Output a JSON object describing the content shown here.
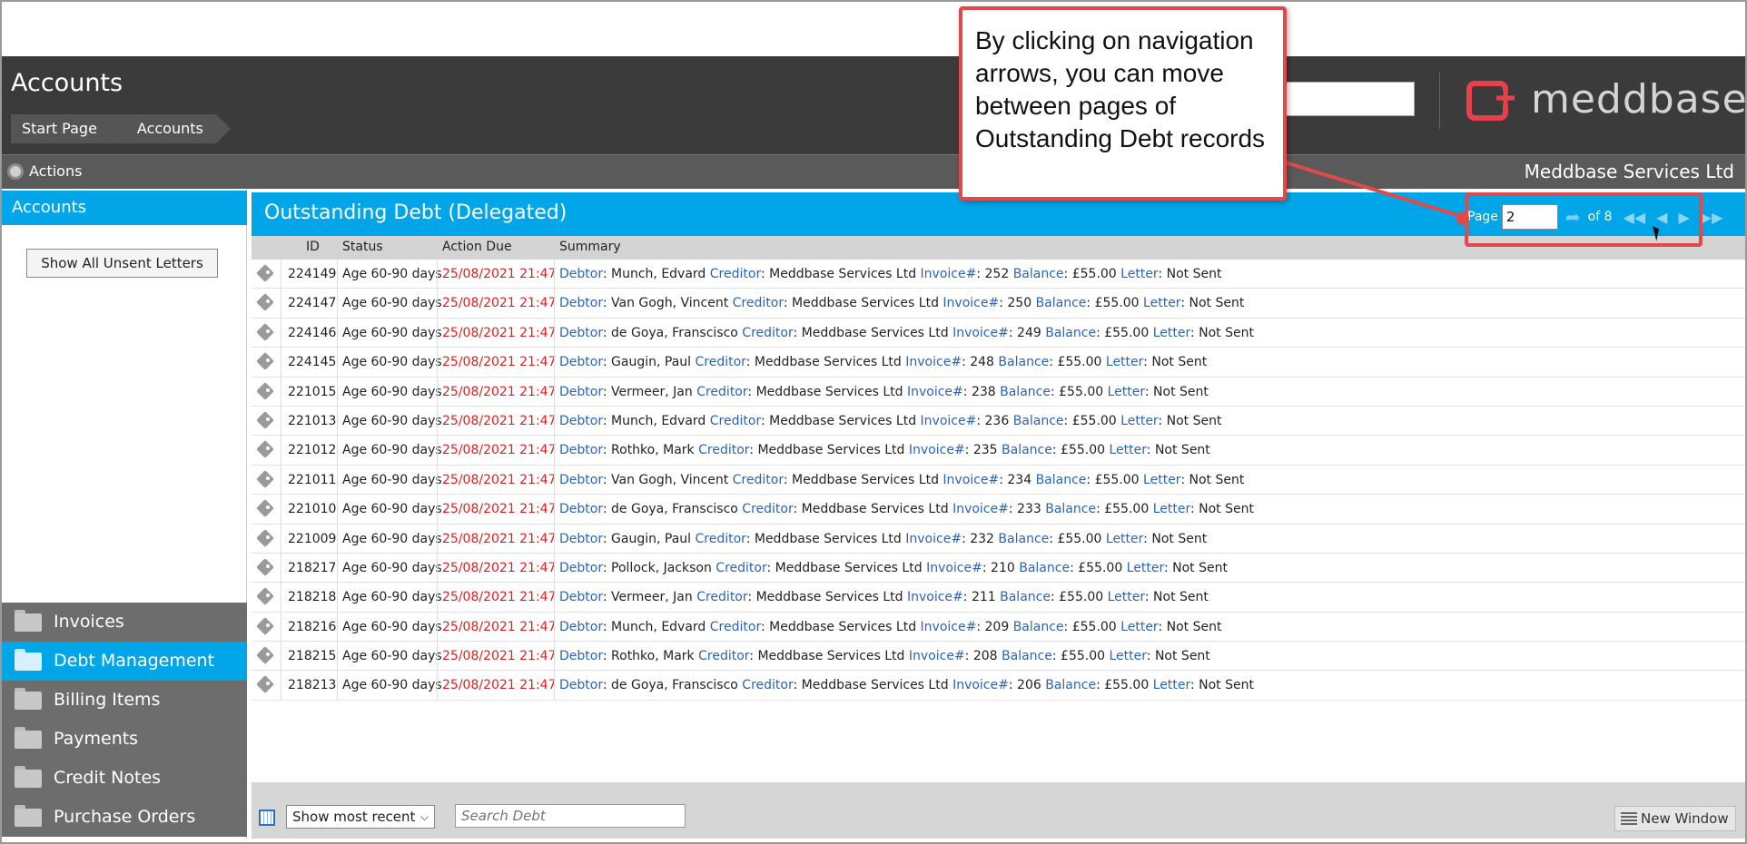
{
  "app": {
    "title": "Accounts",
    "breadcrumb": [
      "Start Page",
      "Accounts"
    ],
    "logo_text": "meddbase",
    "company": "Meddbase Services Ltd",
    "actions_label": "Actions"
  },
  "sidebar": {
    "header": "Accounts",
    "unsent_button": "Show All Unsent Letters",
    "nav": [
      {
        "label": "Invoices",
        "active": false
      },
      {
        "label": "Debt Management",
        "active": true
      },
      {
        "label": "Billing Items",
        "active": false
      },
      {
        "label": "Payments",
        "active": false
      },
      {
        "label": "Credit Notes",
        "active": false
      },
      {
        "label": "Purchase Orders",
        "active": false
      }
    ]
  },
  "main": {
    "title": "Outstanding Debt (Delegated)",
    "pager": {
      "label": "Page",
      "value": "2",
      "of_label": "of 8"
    },
    "columns": [
      "ID",
      "Status",
      "Action Due",
      "Summary"
    ],
    "summary_keys": {
      "debtor": "Debtor",
      "creditor": "Creditor",
      "invoice": "Invoice#",
      "balance": "Balance",
      "letter": "Letter"
    },
    "rows": [
      {
        "id": "224149",
        "status": "Age 60-90 days",
        "due": "25/08/2021 21:47",
        "debtor": "Munch, Edvard",
        "creditor": "Meddbase Services Ltd",
        "invoice": "252",
        "balance": "£55.00",
        "letter": "Not Sent"
      },
      {
        "id": "224147",
        "status": "Age 60-90 days",
        "due": "25/08/2021 21:47",
        "debtor": "Van Gogh, Vincent",
        "creditor": "Meddbase Services Ltd",
        "invoice": "250",
        "balance": "£55.00",
        "letter": "Not Sent"
      },
      {
        "id": "224146",
        "status": "Age 60-90 days",
        "due": "25/08/2021 21:47",
        "debtor": "de Goya, Franscisco",
        "creditor": "Meddbase Services Ltd",
        "invoice": "249",
        "balance": "£55.00",
        "letter": "Not Sent"
      },
      {
        "id": "224145",
        "status": "Age 60-90 days",
        "due": "25/08/2021 21:47",
        "debtor": "Gaugin, Paul",
        "creditor": "Meddbase Services Ltd",
        "invoice": "248",
        "balance": "£55.00",
        "letter": "Not Sent"
      },
      {
        "id": "221015",
        "status": "Age 60-90 days",
        "due": "25/08/2021 21:47",
        "debtor": "Vermeer, Jan",
        "creditor": "Meddbase Services Ltd",
        "invoice": "238",
        "balance": "£55.00",
        "letter": "Not Sent"
      },
      {
        "id": "221013",
        "status": "Age 60-90 days",
        "due": "25/08/2021 21:47",
        "debtor": "Munch, Edvard",
        "creditor": "Meddbase Services Ltd",
        "invoice": "236",
        "balance": "£55.00",
        "letter": "Not Sent"
      },
      {
        "id": "221012",
        "status": "Age 60-90 days",
        "due": "25/08/2021 21:47",
        "debtor": "Rothko, Mark",
        "creditor": "Meddbase Services Ltd",
        "invoice": "235",
        "balance": "£55.00",
        "letter": "Not Sent"
      },
      {
        "id": "221011",
        "status": "Age 60-90 days",
        "due": "25/08/2021 21:47",
        "debtor": "Van Gogh, Vincent",
        "creditor": "Meddbase Services Ltd",
        "invoice": "234",
        "balance": "£55.00",
        "letter": "Not Sent"
      },
      {
        "id": "221010",
        "status": "Age 60-90 days",
        "due": "25/08/2021 21:47",
        "debtor": "de Goya, Franscisco",
        "creditor": "Meddbase Services Ltd",
        "invoice": "233",
        "balance": "£55.00",
        "letter": "Not Sent"
      },
      {
        "id": "221009",
        "status": "Age 60-90 days",
        "due": "25/08/2021 21:47",
        "debtor": "Gaugin, Paul",
        "creditor": "Meddbase Services Ltd",
        "invoice": "232",
        "balance": "£55.00",
        "letter": "Not Sent"
      },
      {
        "id": "218217",
        "status": "Age 60-90 days",
        "due": "25/08/2021 21:47",
        "debtor": "Pollock, Jackson",
        "creditor": "Meddbase Services Ltd",
        "invoice": "210",
        "balance": "£55.00",
        "letter": "Not Sent"
      },
      {
        "id": "218218",
        "status": "Age 60-90 days",
        "due": "25/08/2021 21:47",
        "debtor": "Vermeer, Jan",
        "creditor": "Meddbase Services Ltd",
        "invoice": "211",
        "balance": "£55.00",
        "letter": "Not Sent"
      },
      {
        "id": "218216",
        "status": "Age 60-90 days",
        "due": "25/08/2021 21:47",
        "debtor": "Munch, Edvard",
        "creditor": "Meddbase Services Ltd",
        "invoice": "209",
        "balance": "£55.00",
        "letter": "Not Sent"
      },
      {
        "id": "218215",
        "status": "Age 60-90 days",
        "due": "25/08/2021 21:47",
        "debtor": "Rothko, Mark",
        "creditor": "Meddbase Services Ltd",
        "invoice": "208",
        "balance": "£55.00",
        "letter": "Not Sent"
      },
      {
        "id": "218213",
        "status": "Age 60-90 days",
        "due": "25/08/2021 21:47",
        "debtor": "de Goya, Franscisco",
        "creditor": "Meddbase Services Ltd",
        "invoice": "206",
        "balance": "£55.00",
        "letter": "Not Sent"
      }
    ]
  },
  "footer": {
    "show_select": "Show most recent",
    "search_placeholder": "Search Debt",
    "new_window": "New Window"
  },
  "callout": {
    "text": "By clicking on navigation arrows, you can move between pages of Outstanding Debt records"
  },
  "colors": {
    "accent": "#00a6e8",
    "dark": "#3b3b3b",
    "overdue": "#e02020",
    "key": "#2b63b8",
    "annotation": "#e24a4a"
  }
}
